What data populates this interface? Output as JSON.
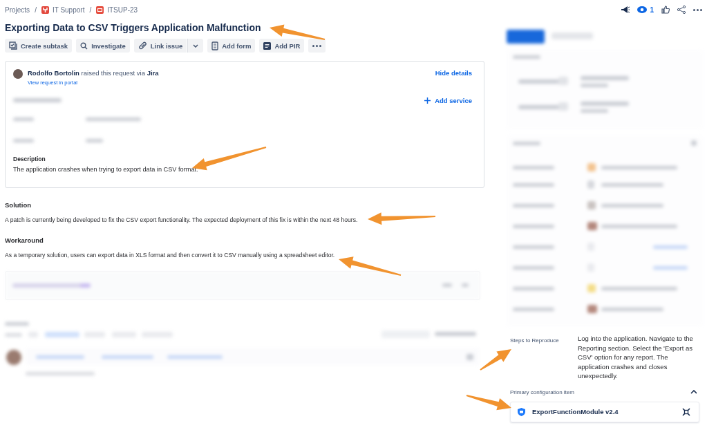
{
  "breadcrumbs": [
    {
      "label": "Projects",
      "kind": "text"
    },
    {
      "label": "IT Support",
      "kind": "project"
    },
    {
      "label": "ITSUP-23",
      "kind": "issue"
    }
  ],
  "breadcrumb_separator": "/",
  "watchers": "1",
  "title": "Exporting Data to CSV Triggers Application Malfunction",
  "toolbar": [
    {
      "label": "Create subtask",
      "kind": "subtask"
    },
    {
      "label": "Investigate",
      "kind": "search"
    },
    {
      "label": "Link issue",
      "kind": "link"
    },
    {
      "kind": "caret"
    },
    {
      "label": "Add form",
      "kind": "form"
    },
    {
      "label": "Add PIR",
      "kind": "pir"
    },
    {
      "kind": "more"
    }
  ],
  "request": {
    "raised": "**Rodolfo Bortolin** raised this request via **Jira**",
    "portal_link": "View request in portal",
    "hide_details": "Hide details",
    "add_service": "Add service"
  },
  "description": {
    "label": "Description",
    "text": "The application crashes when trying to export data in CSV format."
  },
  "sections": [
    {
      "heading": "Solution",
      "text": "A patch is currently being developed to fix the CSV export functionality. The expected deployment of this fix is within the next 48 hours."
    },
    {
      "heading": "Workaround",
      "text": "As a temporary solution, users can export data in XLS format and then convert it to CSV manually using a spreadsheet editor."
    }
  ],
  "side_fields": [
    {
      "label": "Steps to Reproduce",
      "value": "Log into the application. Navigate to the Reporting section. Select the 'Export as CSV' option for any report. The application crashes and closes unexpectedly."
    }
  ],
  "config": {
    "label": "Primary configuration item",
    "expanded": true,
    "item": "ExportFunctionModule v2.4"
  }
}
